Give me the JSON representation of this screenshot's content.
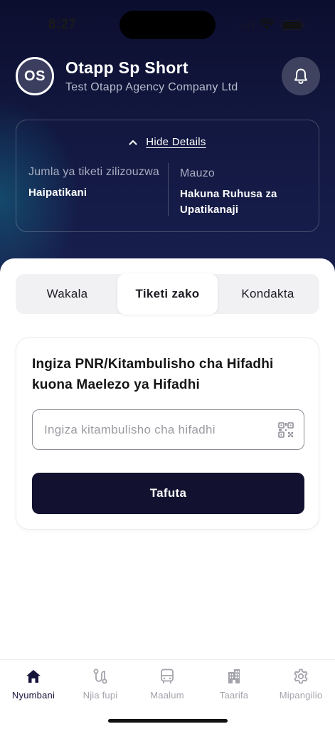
{
  "status_bar": {
    "time": "8:27"
  },
  "header": {
    "avatar_initials": "OS",
    "user_name": "Otapp Sp Short",
    "company": "Test Otapp Agency Company Ltd"
  },
  "details": {
    "toggle_label": "Hide Details",
    "left_label": "Jumla ya tiketi zilizouzwa",
    "left_value": "Haipatikani",
    "right_label": "Mauzo",
    "right_value": "Hakuna Ruhusa za Upatikanaji"
  },
  "tabs": [
    {
      "label": "Wakala",
      "active": false
    },
    {
      "label": "Tiketi zako",
      "active": true
    },
    {
      "label": "Kondakta",
      "active": false
    }
  ],
  "search": {
    "title": "Ingiza PNR/Kitambulisho cha Hifadhi kuona Maelezo ya Hifadhi",
    "placeholder": "Ingiza kitambulisho cha hifadhi",
    "button_label": "Tafuta"
  },
  "bottom_nav": [
    {
      "label": "Nyumbani",
      "icon": "home-icon",
      "active": true
    },
    {
      "label": "Njia fupi",
      "icon": "route-icon",
      "active": false
    },
    {
      "label": "Maalum",
      "icon": "bus-icon",
      "active": false
    },
    {
      "label": "Taarifa",
      "icon": "building-icon",
      "active": false
    },
    {
      "label": "Mipangilio",
      "icon": "gear-icon",
      "active": false
    }
  ],
  "colors": {
    "header_bg": "#121840",
    "primary_button": "#12112f",
    "nav_active": "#14133a",
    "nav_inactive": "#a3a3ab"
  }
}
